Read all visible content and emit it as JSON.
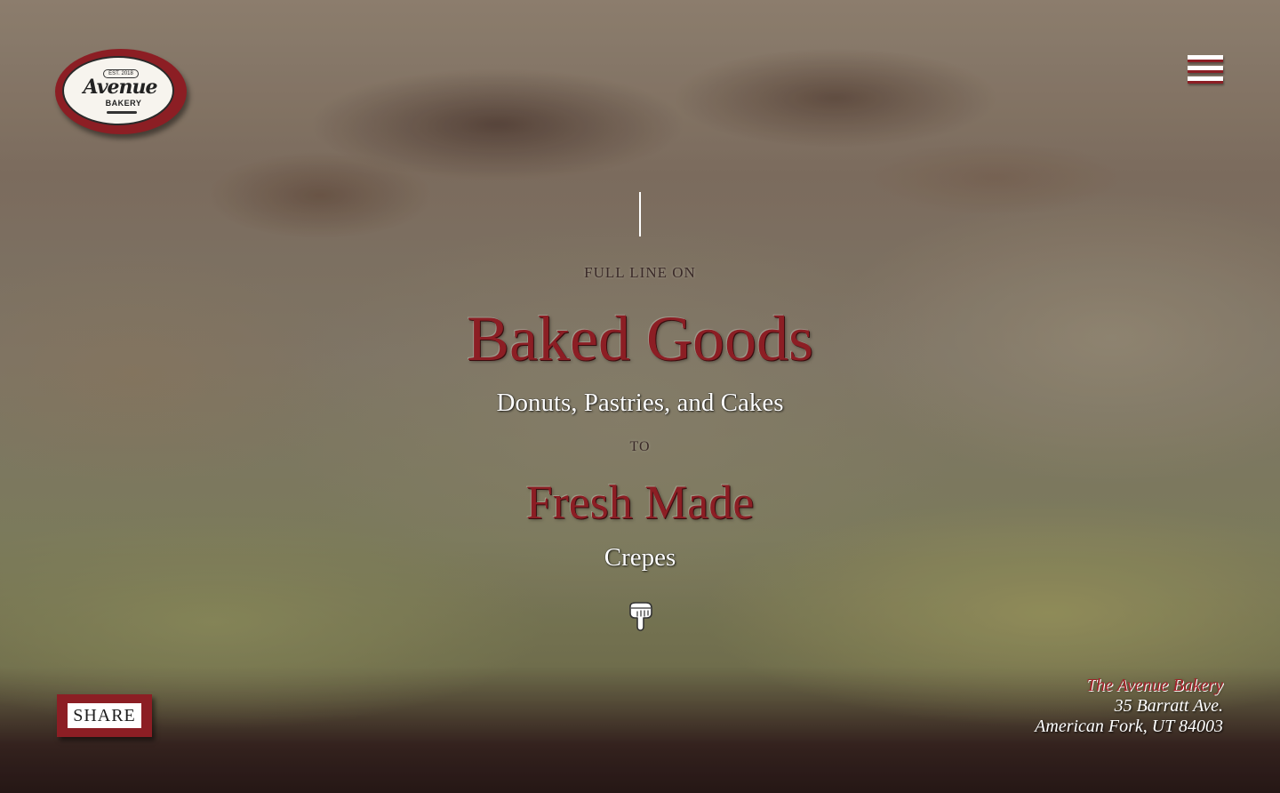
{
  "logo": {
    "est": "EST. 2018",
    "name": "Avenue",
    "sub": "BAKERY"
  },
  "hero": {
    "kicker1": "FULL LINE ON",
    "headline1": "Baked Goods",
    "subline1": "Donuts, Pastries, and Cakes",
    "kicker2": "TO",
    "headline2": "Fresh Made",
    "subline2": "Crepes",
    "scroll_icon": "pointing-down-hand-icon"
  },
  "menu": {
    "icon": "hamburger-menu-icon"
  },
  "share": {
    "label": "SHARE"
  },
  "address": {
    "business": "The Avenue Bakery",
    "street": "35 Barratt Ave.",
    "city": "American Fork, UT 84003"
  },
  "colors": {
    "brand_red": "#8c1e24",
    "text_white": "#ffffff"
  }
}
